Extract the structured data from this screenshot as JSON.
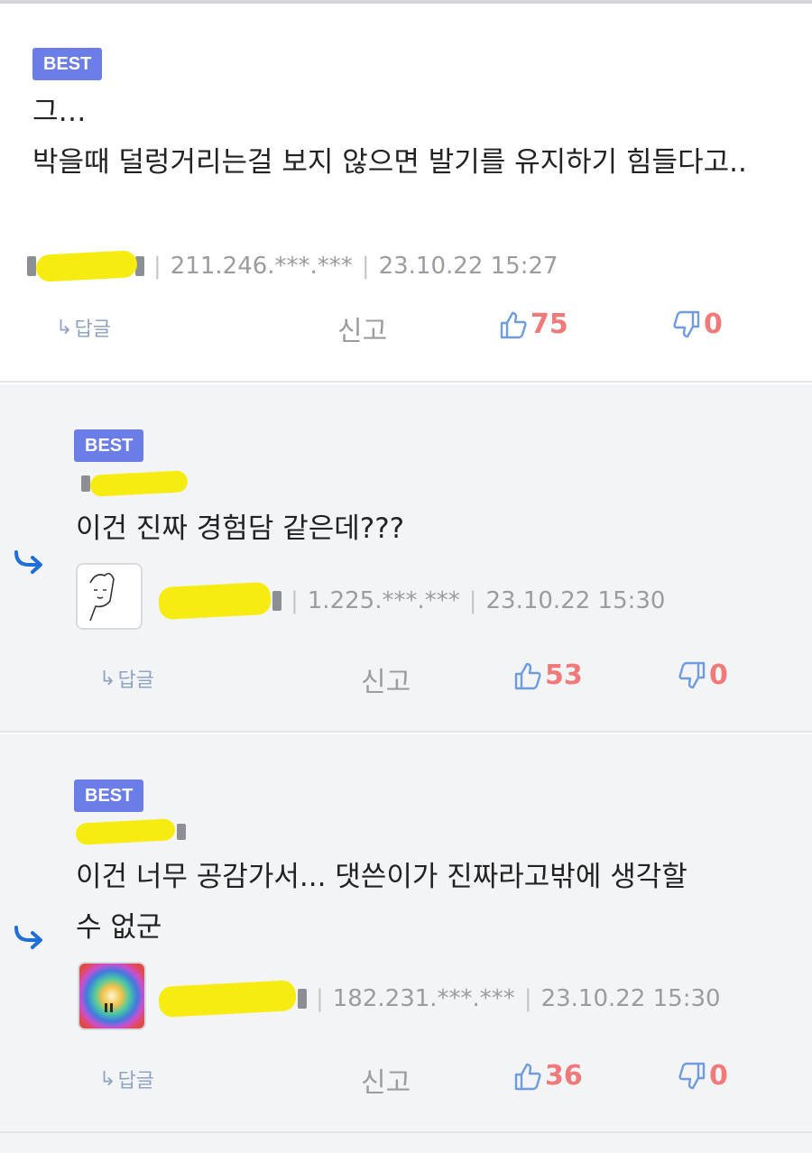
{
  "badge_label": "BEST",
  "actions": {
    "reply_label": "답글",
    "report_label": "신고"
  },
  "comments": [
    {
      "text": "그…\n박을때 덜렁거리는걸 보지 않으면 발기를 유지하기 힘들다고..",
      "ip": "211.246.***.***",
      "time": "23.10.22 15:27",
      "likes": "75",
      "dislikes": "0"
    },
    {
      "text": "이건 진짜 경험담 같은데???",
      "ip": "1.225.***.***",
      "time": "23.10.22 15:30",
      "likes": "53",
      "dislikes": "0"
    },
    {
      "text": "이건 너무 공감가서... 댓쓴이가 진짜라고밖에 생각할\n수 없군",
      "ip": "182.231.***.***",
      "time": "23.10.22 15:30",
      "likes": "36",
      "dislikes": "0"
    }
  ],
  "colors": {
    "badge": "#6b7ee8",
    "like_count": "#f07a7a",
    "icon_blue": "#6f9ce0",
    "reply_arrow": "#1f6fd6",
    "redaction": "#f7ec12"
  }
}
